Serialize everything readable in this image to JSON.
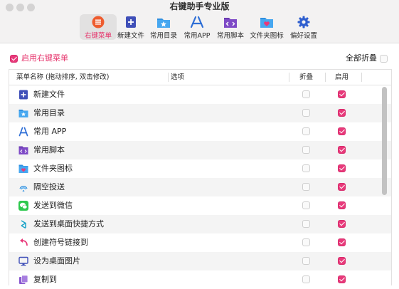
{
  "window": {
    "title": "右键助手专业版"
  },
  "toolbar": {
    "items": [
      {
        "label": "右键菜单",
        "icon": "menu-list-icon",
        "active": true
      },
      {
        "label": "新建文件",
        "icon": "new-file-icon",
        "active": false
      },
      {
        "label": "常用目录",
        "icon": "folder-star-icon",
        "active": false
      },
      {
        "label": "常用APP",
        "icon": "app-store-icon",
        "active": false
      },
      {
        "label": "常用脚本",
        "icon": "script-icon",
        "active": false
      },
      {
        "label": "文件夹图标",
        "icon": "folder-heart-icon",
        "active": false
      },
      {
        "label": "偏好设置",
        "icon": "gear-icon",
        "active": false
      }
    ]
  },
  "options": {
    "enable_label": "启用右键菜单",
    "enable_checked": true,
    "collapse_all_label": "全部折叠",
    "collapse_all_checked": false
  },
  "table": {
    "headers": {
      "name": "菜单名称 (拖动排序, 双击修改)",
      "options": "选项",
      "fold": "折叠",
      "enable": "启用"
    },
    "rows": [
      {
        "name": "新建文件",
        "icon": "new-file-icon",
        "fold": false,
        "enabled": true
      },
      {
        "name": "常用目录",
        "icon": "folder-star-icon",
        "fold": false,
        "enabled": true
      },
      {
        "name": "常用 APP",
        "icon": "app-store-icon",
        "fold": false,
        "enabled": true
      },
      {
        "name": "常用脚本",
        "icon": "script-icon",
        "fold": false,
        "enabled": true
      },
      {
        "name": "文件夹图标",
        "icon": "folder-heart-icon",
        "fold": false,
        "enabled": true
      },
      {
        "name": "隔空投送",
        "icon": "airdrop-icon",
        "fold": false,
        "enabled": true
      },
      {
        "name": "发送到微信",
        "icon": "wechat-icon",
        "fold": false,
        "enabled": true
      },
      {
        "name": "发送到桌面快捷方式",
        "icon": "shortcut-icon",
        "fold": false,
        "enabled": true
      },
      {
        "name": "创建符号链接到",
        "icon": "symlink-icon",
        "fold": false,
        "enabled": true
      },
      {
        "name": "设为桌面图片",
        "icon": "desktop-picture-icon",
        "fold": false,
        "enabled": true
      },
      {
        "name": "复制到",
        "icon": "copy-to-icon",
        "fold": false,
        "enabled": true
      }
    ]
  },
  "colors": {
    "accent": "#e8397a",
    "toolbar_icon": "#3f5bd9"
  }
}
